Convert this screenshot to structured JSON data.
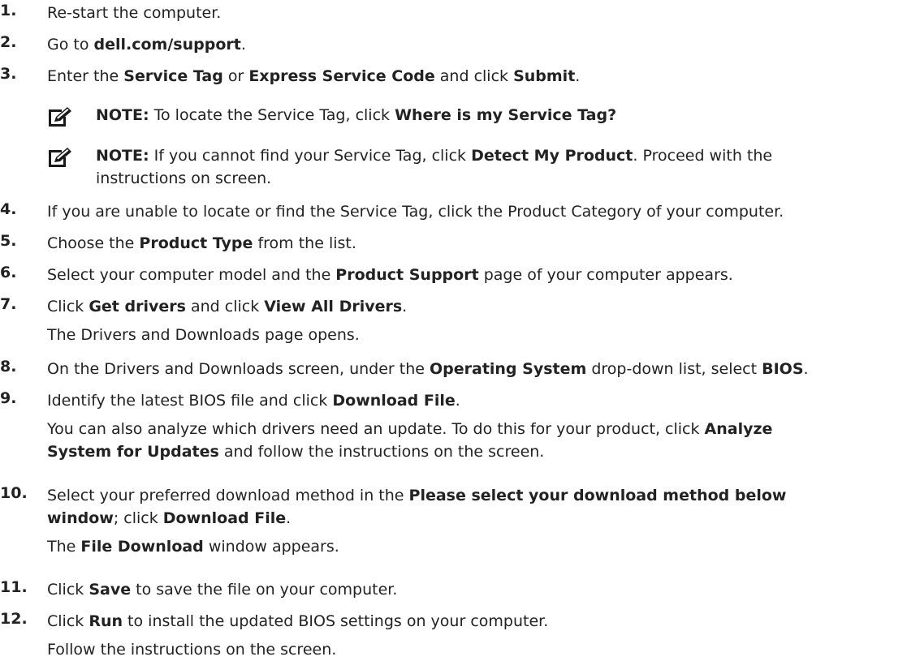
{
  "steps": [
    {
      "num": "1.",
      "parts": [
        {
          "t": "Re-start the computer."
        }
      ]
    },
    {
      "num": "2.",
      "parts": [
        {
          "t": "Go to "
        },
        {
          "t": "dell.com/support",
          "b": 1
        },
        {
          "t": "."
        }
      ]
    },
    {
      "num": "3.",
      "parts": [
        {
          "t": "Enter the "
        },
        {
          "t": "Service Tag",
          "b": 1
        },
        {
          "t": " or "
        },
        {
          "t": "Express Service Code",
          "b": 1
        },
        {
          "t": " and click "
        },
        {
          "t": "Submit",
          "b": 1
        },
        {
          "t": "."
        }
      ],
      "notes": [
        {
          "label": "NOTE:",
          "parts": [
            {
              "t": " To locate the Service Tag, click "
            },
            {
              "t": "Where is my Service Tag?",
              "b": 1
            }
          ]
        },
        {
          "label": "NOTE:",
          "parts": [
            {
              "t": " If you cannot find your Service Tag, click "
            },
            {
              "t": "Detect My Product",
              "b": 1
            },
            {
              "t": ". Proceed with the "
            },
            {
              "br": 1
            },
            {
              "t": "instructions on screen."
            }
          ]
        }
      ]
    },
    {
      "num": "4.",
      "parts": [
        {
          "t": "If you are unable to locate or find the Service Tag, click the Product Category of your computer."
        }
      ]
    },
    {
      "num": "5.",
      "parts": [
        {
          "t": "Choose the "
        },
        {
          "t": "Product Type",
          "b": 1
        },
        {
          "t": " from the list."
        }
      ]
    },
    {
      "num": "6.",
      "parts": [
        {
          "t": "Select your computer model and the "
        },
        {
          "t": "Product Support",
          "b": 1
        },
        {
          "t": " page of your computer appears."
        }
      ]
    },
    {
      "num": "7.",
      "parts": [
        {
          "t": "Click "
        },
        {
          "t": "Get drivers",
          "b": 1
        },
        {
          "t": " and click "
        },
        {
          "t": "View All Drivers",
          "b": 1
        },
        {
          "t": "."
        }
      ],
      "sub": [
        [
          {
            "t": "The Drivers and Downloads page opens."
          }
        ]
      ]
    },
    {
      "num": "8.",
      "parts": [
        {
          "t": "On the Drivers and Downloads screen, under the "
        },
        {
          "t": "Operating System",
          "b": 1
        },
        {
          "t": " drop-down list, select "
        },
        {
          "t": "BIOS",
          "b": 1
        },
        {
          "t": "."
        }
      ]
    },
    {
      "num": "9.",
      "parts": [
        {
          "t": "Identify the latest BIOS file and click "
        },
        {
          "t": "Download File",
          "b": 1
        },
        {
          "t": "."
        }
      ],
      "sub": [
        [
          {
            "t": "You can also analyze which drivers need an update. To do this for your product, click "
          },
          {
            "t": "Analyze",
            "b": 1
          },
          {
            "br": 1
          },
          {
            "t": "System for Updates",
            "b": 1
          },
          {
            "t": " and follow the instructions on the screen."
          }
        ]
      ]
    },
    {
      "num": "10.",
      "parts": [
        {
          "t": "Select your preferred download method in the "
        },
        {
          "t": "Please select your download method below",
          "b": 1
        },
        {
          "br": 1
        },
        {
          "t": "window",
          "b": 1
        },
        {
          "t": "; click "
        },
        {
          "t": "Download File",
          "b": 1
        },
        {
          "t": "."
        }
      ],
      "sub": [
        [
          {
            "t": "The "
          },
          {
            "t": "File Download",
            "b": 1
          },
          {
            "t": " window appears."
          }
        ]
      ]
    },
    {
      "num": "11.",
      "parts": [
        {
          "t": "Click "
        },
        {
          "t": "Save",
          "b": 1
        },
        {
          "t": " to save the file on your computer."
        }
      ]
    },
    {
      "num": "12.",
      "parts": [
        {
          "t": "Click "
        },
        {
          "t": "Run",
          "b": 1
        },
        {
          "t": " to install the updated BIOS settings on your computer."
        }
      ],
      "sub": [
        [
          {
            "t": "Follow the instructions on the screen."
          }
        ]
      ]
    }
  ]
}
